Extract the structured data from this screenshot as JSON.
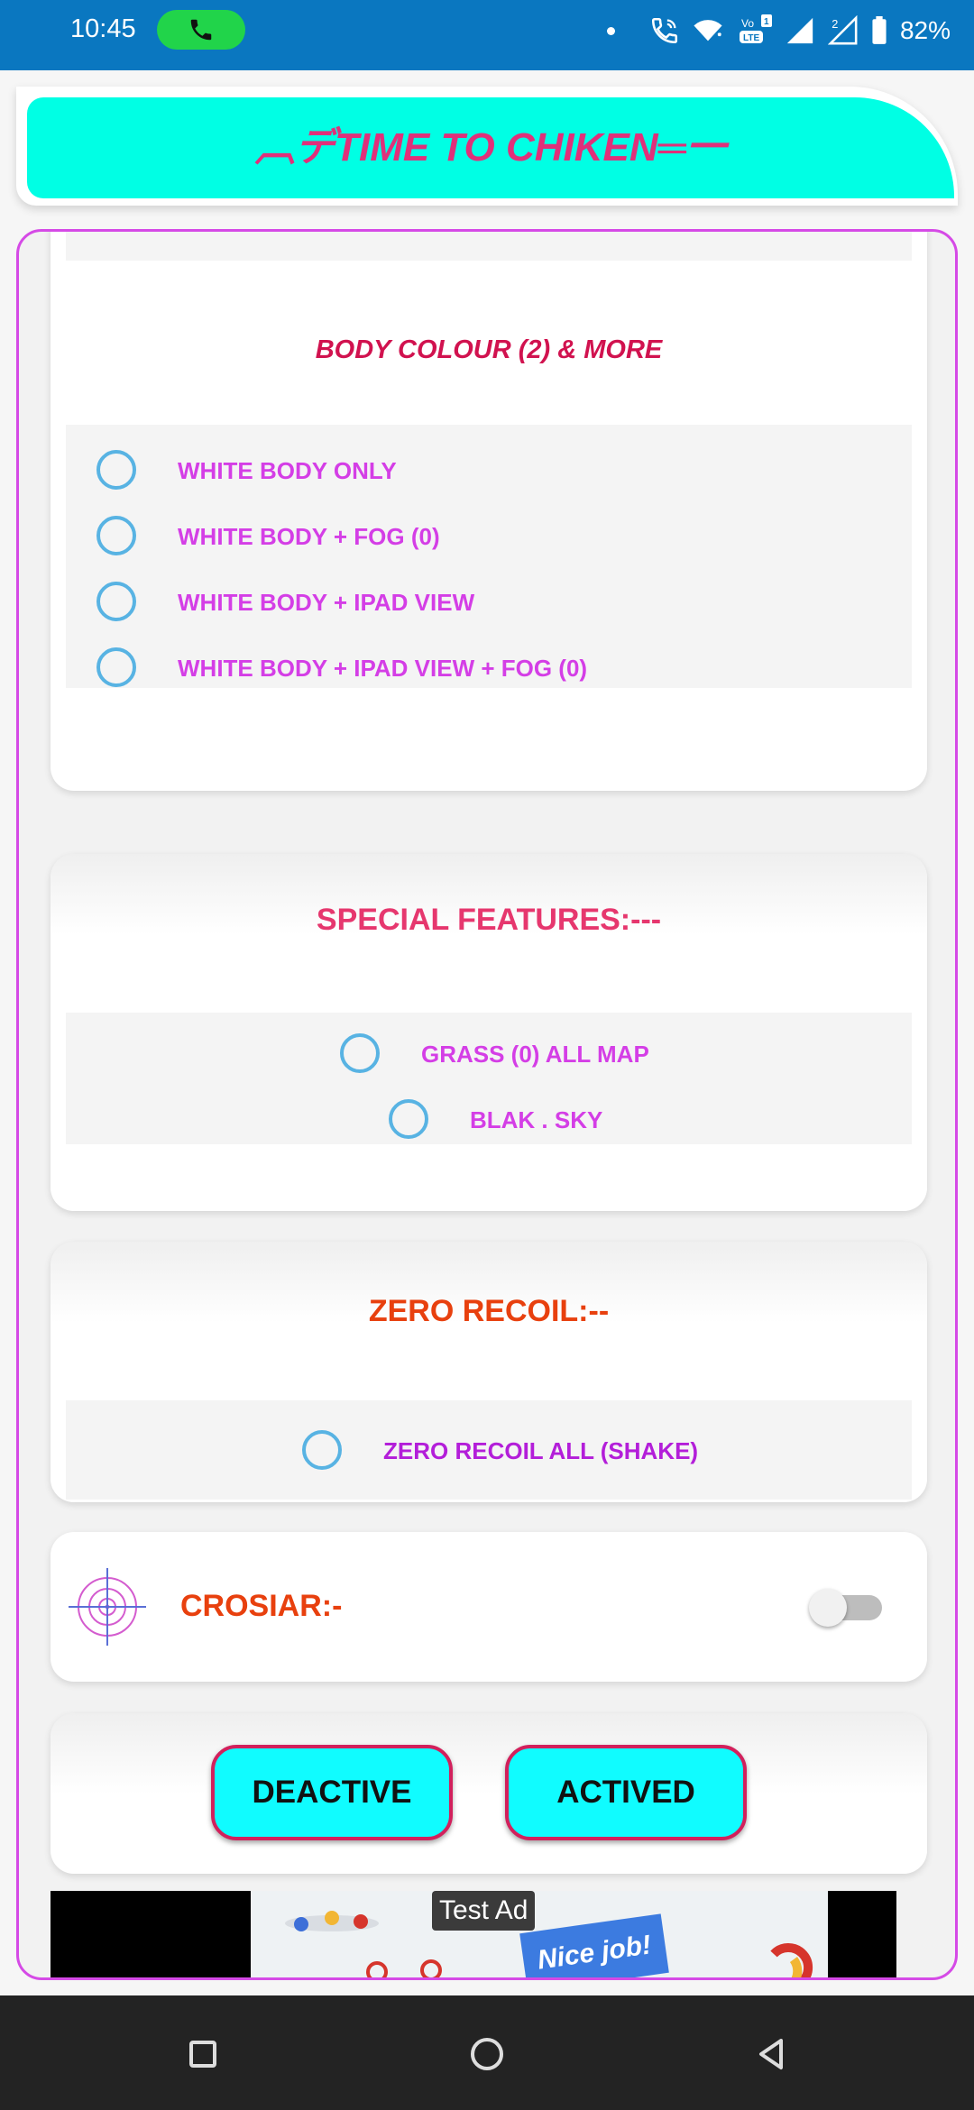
{
  "status_bar": {
    "time": "10:45",
    "battery_percent": "82%",
    "sim2_label": "2",
    "volte_label": "Vo LTE",
    "colors": {
      "background": "#0a77c0",
      "call_pill": "#21d44a"
    }
  },
  "header": {
    "title": "︹デTIME TO CHIKEN═一",
    "colors": {
      "fill": "#00ffe4",
      "text": "#e0307a"
    }
  },
  "body_colour_section": {
    "title": "BODY COLOUR (2) & MORE",
    "options": [
      {
        "label": "WHITE BODY ONLY",
        "selected": false
      },
      {
        "label": "WHITE BODY + FOG (0)",
        "selected": false
      },
      {
        "label": "WHITE BODY + IPAD VIEW",
        "selected": false
      },
      {
        "label": "WHITE BODY + IPAD VIEW + FOG (0)",
        "selected": false
      }
    ]
  },
  "special_features_section": {
    "title": "SPECIAL FEATURES:---",
    "options": [
      {
        "label": "GRASS (0) ALL MAP",
        "selected": false
      },
      {
        "label": "BLAK . SKY",
        "selected": false
      }
    ]
  },
  "zero_recoil_section": {
    "title": "ZERO RECOIL:--",
    "options": [
      {
        "label": "ZERO RECOIL ALL (SHAKE)",
        "selected": false
      }
    ]
  },
  "crosshair_section": {
    "label": "CROSIAR:-",
    "toggle_on": false,
    "icon": "crosshair-icon"
  },
  "actions": {
    "deactive_label": "DEACTIVE",
    "actived_label": "ACTIVED"
  },
  "ad_banner": {
    "test_label": "Test Ad",
    "nice_job_text": "Nice job!"
  },
  "colors": {
    "frame_border": "#d54ae6",
    "radio": "#58b3e3",
    "option_text": "#d43ee6",
    "zero_recoil_option_text": "#b31ed9",
    "body_colour_title": "#d1124f",
    "special_features_title": "#e6376e",
    "zero_recoil_title": "#e8400e",
    "crosiar_text": "#e8400e",
    "button_fill": "#10fcff",
    "button_border": "#d2205c"
  },
  "nav_bar": {
    "icons": [
      "square-recents-icon",
      "circle-home-icon",
      "triangle-back-icon"
    ]
  }
}
